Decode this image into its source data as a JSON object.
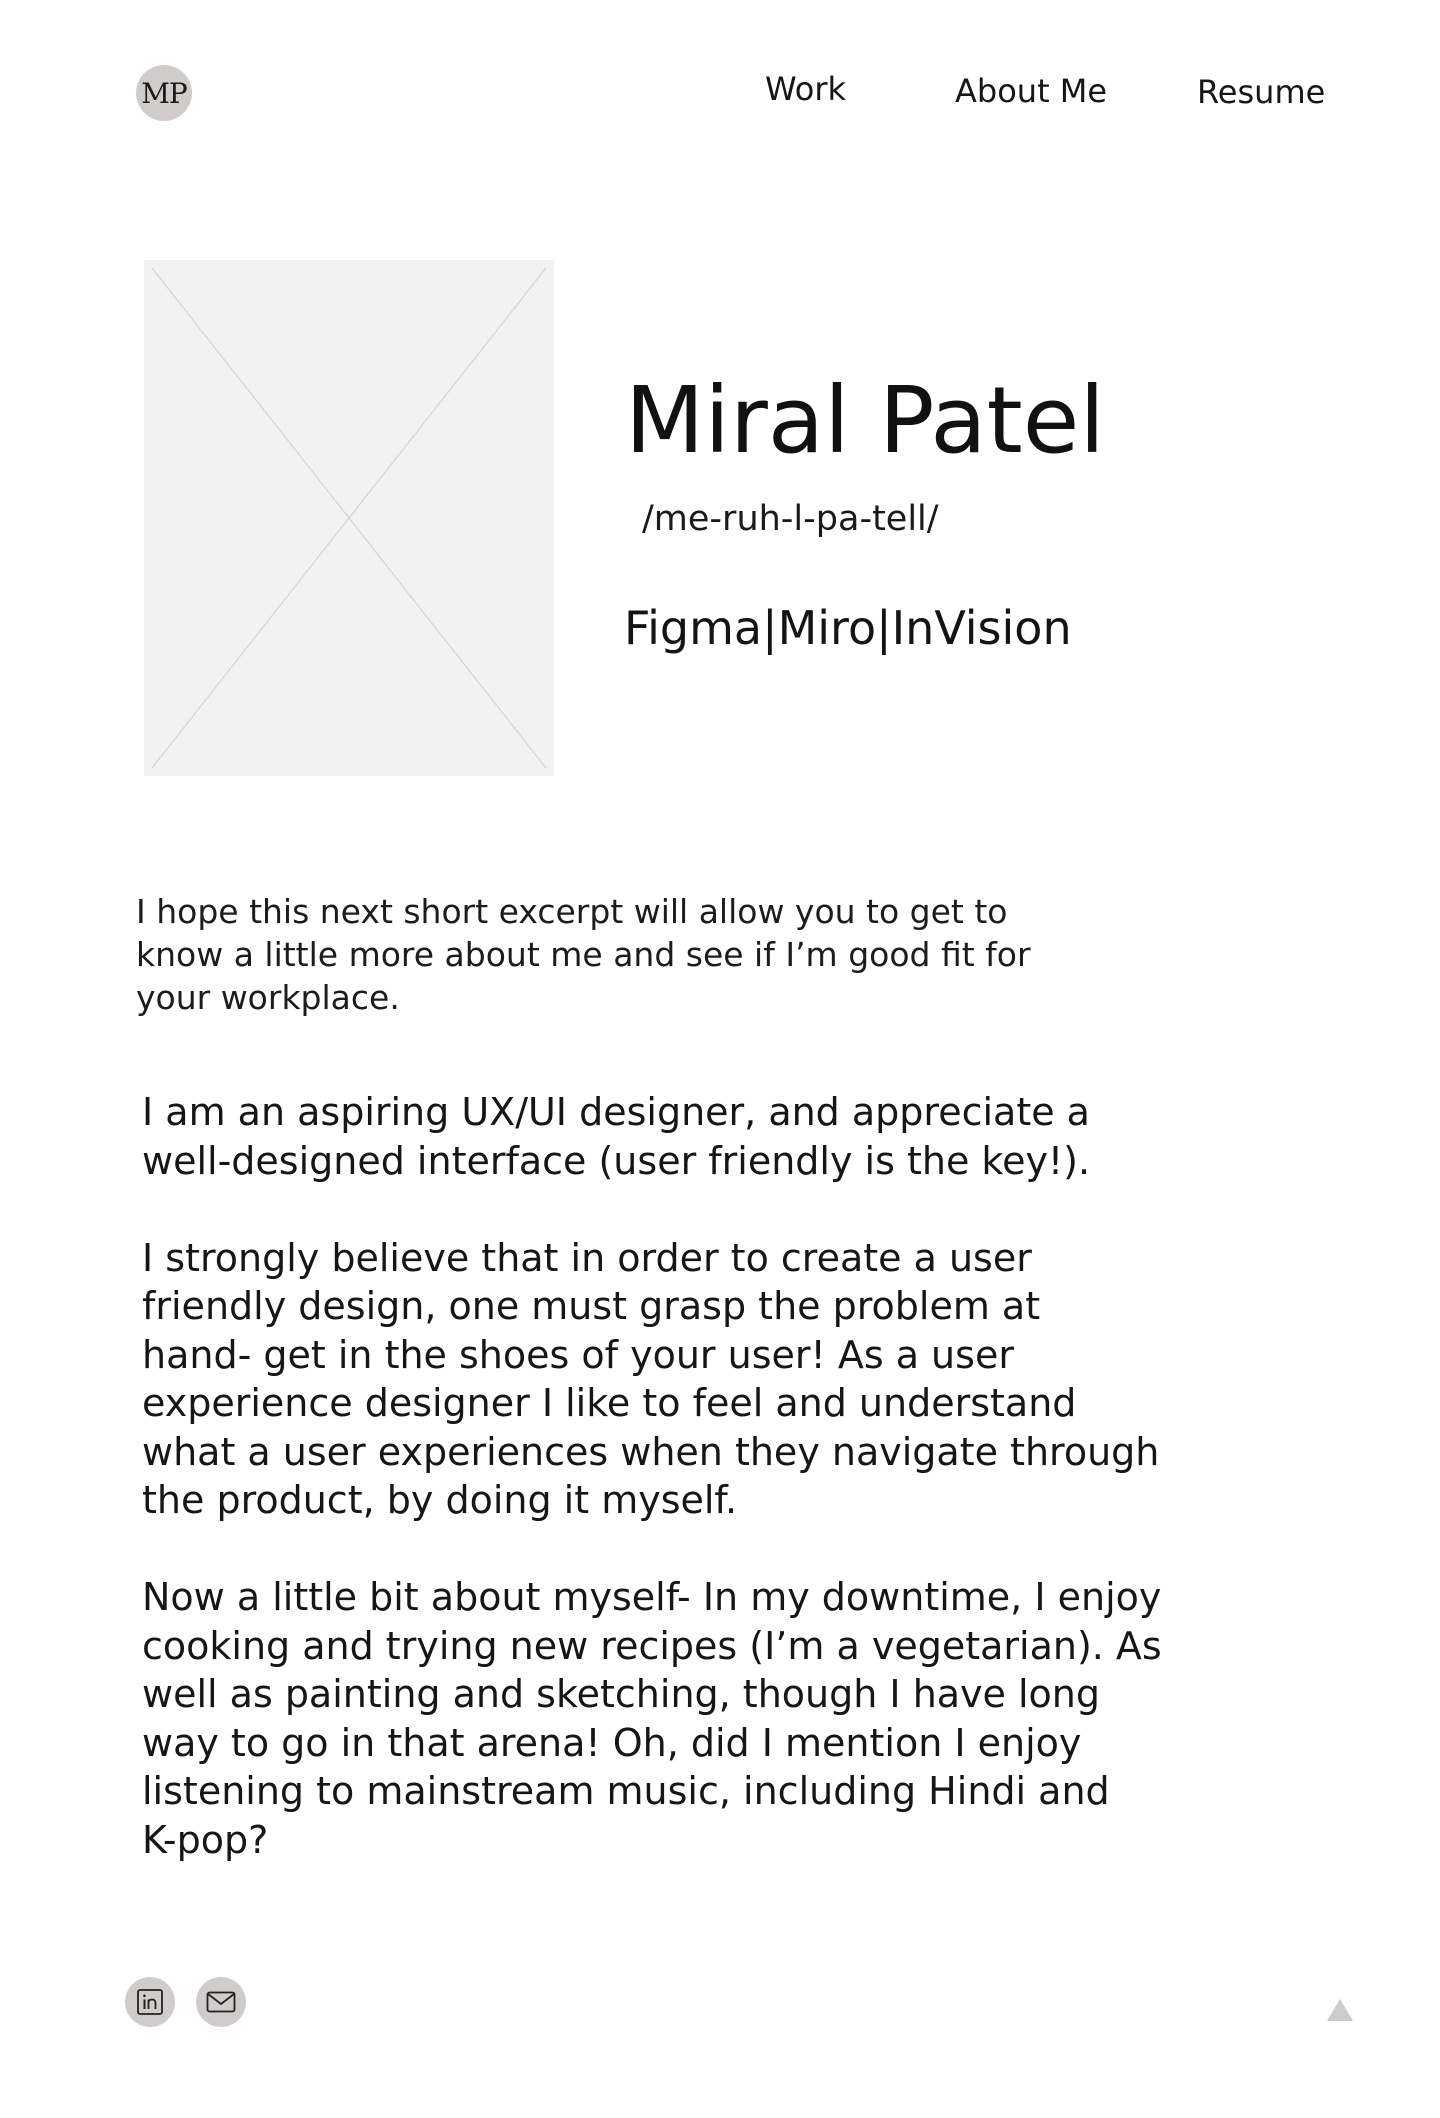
{
  "header": {
    "logo_text": "MP",
    "nav": {
      "work": "Work",
      "about": "About Me",
      "resume": "Resume"
    }
  },
  "profile": {
    "photo_icon": "image-placeholder-icon",
    "name": "Miral Patel",
    "pronunciation": "/me-ruh-l-pa-tell/",
    "tools": "Figma|Miro|InVision"
  },
  "intro": {
    "line1": "I hope this next short excerpt will allow you to get to",
    "line2": "know a little more about me and see if I’m good fit for",
    "line3": "your workplace."
  },
  "bio": {
    "p1": [
      "I am an aspiring UX/UI designer, and appreciate a",
      "well-designed interface (user friendly is the key!)."
    ],
    "p2": [
      "I strongly believe that in order to create a user",
      "friendly design, one must grasp the problem at",
      "hand- get in the shoes of your user! As a user",
      "experience designer I like to feel and understand",
      "what a user experiences when they navigate through",
      "the product, by doing it myself."
    ],
    "p3": [
      "Now a little bit about myself- In my downtime, I enjoy",
      "cooking and trying new recipes (I’m a vegetarian). As",
      "well as painting and sketching, though I have long",
      "way to go in that arena! Oh, did I mention I enjoy",
      "listening to mainstream music, including Hindi and",
      "K-pop?"
    ]
  },
  "footer": {
    "linkedin_icon": "linkedin-icon",
    "email_icon": "mail-icon",
    "top_icon": "triangle-up-icon"
  },
  "colors": {
    "icon_circle": "#cfcccb",
    "photo_placeholder": "#f2f2f2",
    "text": "#161616",
    "top_arrow": "#cccccc"
  }
}
